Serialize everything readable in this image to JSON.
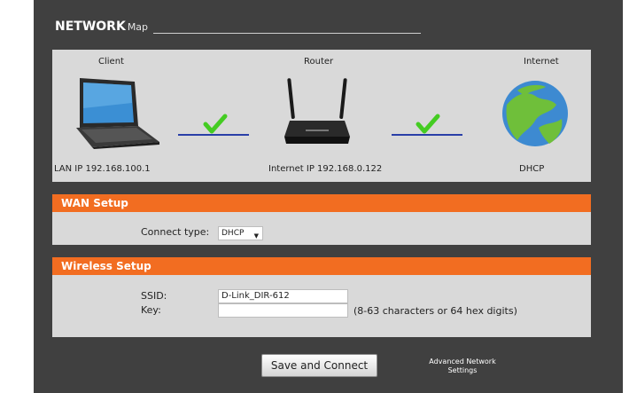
{
  "header": {
    "title": "NETWORK",
    "subtitle": "Map"
  },
  "network_map": {
    "client": {
      "label": "Client",
      "ip": "LAN IP 192.168.100.1"
    },
    "router": {
      "label": "Router",
      "ip": "Internet IP 192.168.0.122"
    },
    "internet": {
      "label": "Internet",
      "status": "DHCP"
    },
    "colors": {
      "line": "#2a3fa8",
      "check": "#44cc22"
    }
  },
  "wan": {
    "heading": "WAN Setup",
    "connect_type_label": "Connect type:",
    "connect_type_value": "DHCP"
  },
  "wireless": {
    "heading": "Wireless Setup",
    "ssid_label": "SSID:",
    "ssid_value": "D-Link_DIR-612",
    "key_label": "Key:",
    "key_value": "",
    "key_hint": "(8-63 characters or 64 hex digits)"
  },
  "actions": {
    "save_label": "Save and Connect",
    "advanced_line1": "Advanced Network",
    "advanced_line2": "Settings"
  },
  "theme": {
    "accent": "#f26d21",
    "frame": "#404040",
    "panel": "#d9d9d9"
  }
}
